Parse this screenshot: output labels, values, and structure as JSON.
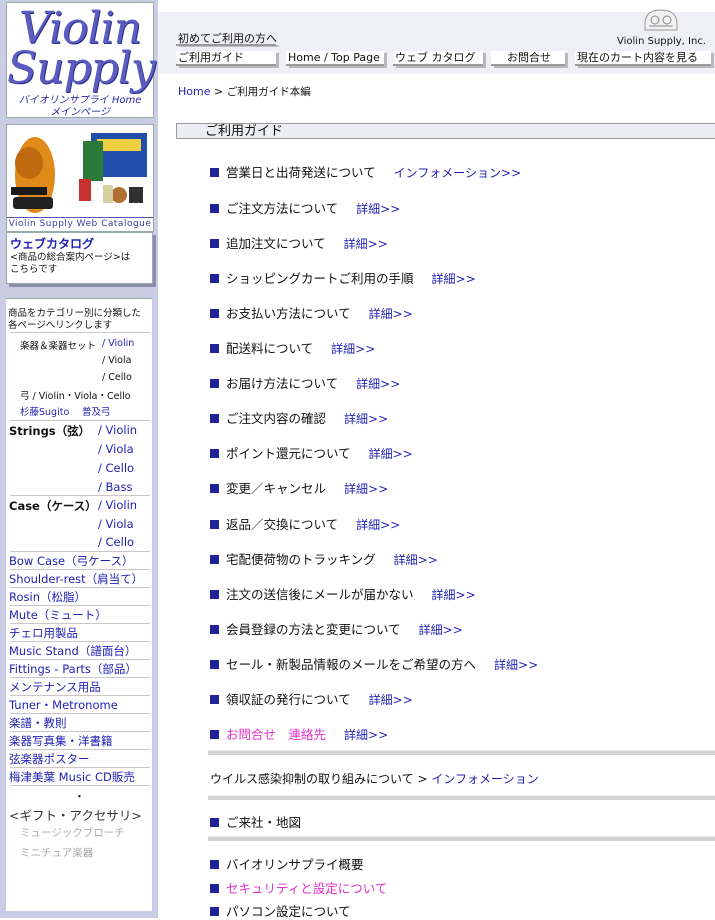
{
  "logo": {
    "line1": "Violin",
    "line2": "Supply",
    "sub1": "バイオリンサプライ Home",
    "sub2": "メインページ"
  },
  "catalog_image": {
    "banner": "Violin Supply Web Catalogue"
  },
  "webcat": {
    "title": "ウェブカタログ",
    "desc1": "<商品の総合案内ページ>は",
    "desc2": "こちらです"
  },
  "nav": {
    "intro1": "商品をカテゴリー別に分類した",
    "intro2": "各ページへリンクします",
    "instruments": {
      "label": "楽器＆楽器セット",
      "violin": "/ Violin",
      "viola": "/ Viola",
      "cello": "/ Cello"
    },
    "bow": {
      "label": "弓 / Violin・Viola・Cello",
      "sugito": "杉藤Sugito",
      "fukyu": "普及弓"
    },
    "strings": {
      "label": "Strings（弦）",
      "violin": "/ Violin",
      "viola": "/ Viola",
      "cello": "/ Cello",
      "bass": "/ Bass"
    },
    "case": {
      "label": "Case（ケース）",
      "violin": "/ Violin",
      "viola": "/ Viola",
      "cello": "/ Cello"
    },
    "links": [
      "Bow Case（弓ケース）",
      "Shoulder-rest（肩当て）",
      "Rosin（松脂）",
      "Mute（ミュート）",
      "チェロ用製品",
      "Music Stand（譜面台）",
      "Fittings - Parts（部品）",
      "メンテナンス用品",
      "Tuner・Metronome",
      "楽譜・教則",
      "楽器写真集・洋書籍",
      "弦楽器ポスター",
      "梅津美葉 Music CD販売"
    ],
    "dot": "・",
    "gift": "<ギフト・アクセサリ>",
    "brooch": "ミュージックブローチ",
    "miniature": "ミニチュア楽器"
  },
  "topbar": {
    "first_time": "初めてご利用の方へ",
    "guide": "ご利用ガイド",
    "home": "Home / Top Page",
    "catalog": "ウェブ カタログ",
    "contact": "お問合せ",
    "cart": "現在のカート内容を見る",
    "brand": "Violin Supply, Inc."
  },
  "breadcrumb": {
    "home": "Home",
    "sep": " > ",
    "current": "ご利用ガイド本編"
  },
  "guide": {
    "heading": "ご利用ガイド",
    "items": [
      {
        "text": "営業日と出荷発送について",
        "link": "インフォメーション>>"
      },
      {
        "text": "ご注文方法について",
        "link": "詳細>>"
      },
      {
        "text": "追加注文について",
        "link": "詳細>>"
      },
      {
        "text": "ショッピングカートご利用の手順",
        "link": "詳細>>"
      },
      {
        "text": "お支払い方法について",
        "link": "詳細>>"
      },
      {
        "text": "配送料について",
        "link": "詳細>>"
      },
      {
        "text": "お届け方法について",
        "link": "詳細>>"
      },
      {
        "text": "ご注文内容の確認",
        "link": "詳細>>"
      },
      {
        "text": "ポイント還元について",
        "link": "詳細>>"
      },
      {
        "text": "変更／キャンセル",
        "link": "詳細>>"
      },
      {
        "text": "返品／交換について",
        "link": "詳細>>"
      },
      {
        "text": "宅配便荷物のトラッキング",
        "link": "詳細>>"
      },
      {
        "text": "注文の送信後にメールが届かない",
        "link": "詳細>>"
      },
      {
        "text": "会員登録の方法と変更について",
        "link": "詳細>>"
      },
      {
        "text": "セール・新製品情報のメールをご希望の方へ",
        "link": "詳細>>"
      },
      {
        "text": "領収証の発行について",
        "link": "詳細>>"
      },
      {
        "text": "お問合せ　連絡先",
        "link": "詳細>>"
      }
    ],
    "virus_text": "ウイルス感染抑制の取り組みについて > ",
    "virus_link": "インフォメーション",
    "visit": "ご来社・地図",
    "overview": "バイオリンサプライ概要",
    "security": "セキュリティと設定について",
    "pc": "パソコン設定について"
  },
  "colors": {
    "sidebar_bg": "#c9cde3",
    "link": "#1f1fb3",
    "pink": "#e030c8",
    "bullet": "#232399"
  }
}
